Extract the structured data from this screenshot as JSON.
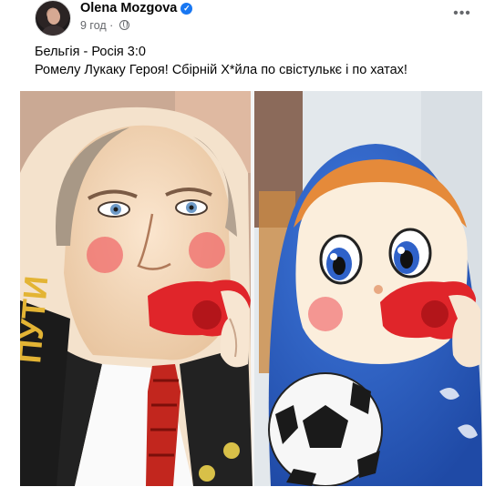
{
  "post": {
    "author": "Olena Mozgova",
    "time": "9 год",
    "verified": true,
    "lines": [
      "Бельгія - Росія 3:0",
      "Ромелу Лукаку Героя! Сбірній Х*йла по свістулькє і по хатах!"
    ],
    "more_icon": "ellipsis-icon",
    "privacy_icon": "globe-icon",
    "image": {
      "left_doll_scarf_text": "ПУТИ",
      "colors": {
        "left_bg": "#c9a78f",
        "right_bg": "#e7ecf0",
        "doll_blue": "#2a5fc2",
        "hair_orange": "#e58a3a",
        "whistle_red": "#e0252a"
      }
    }
  }
}
